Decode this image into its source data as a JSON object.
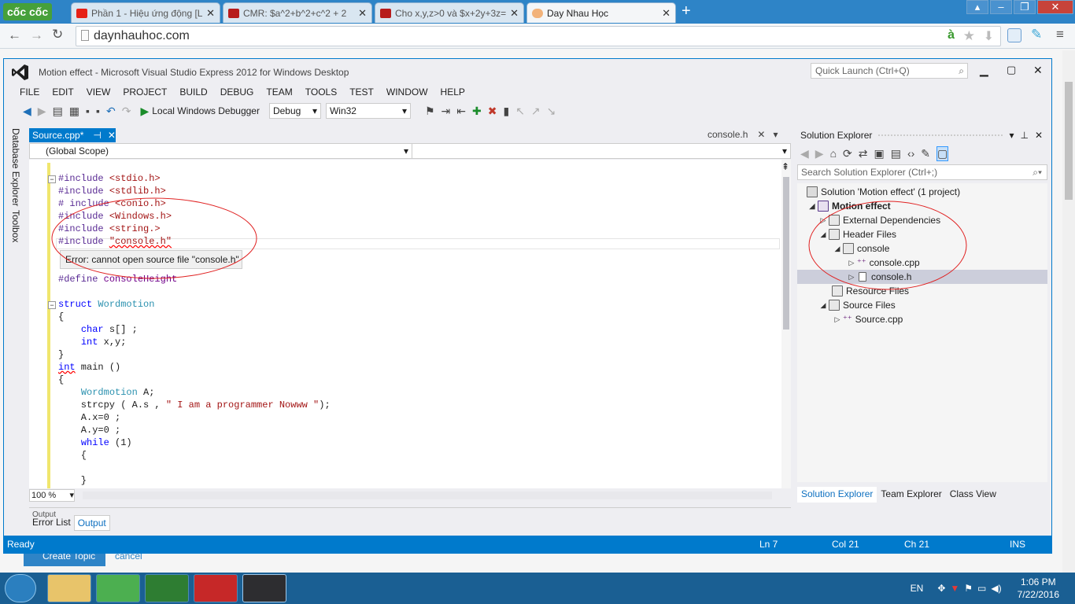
{
  "browser": {
    "logo": "cốc cốc",
    "tabs": [
      {
        "title": "Phần 1 - Hiệu ứng động [L",
        "fav_color": "#e62117"
      },
      {
        "title": "CMR: $a^2+b^2+c^2 + 2",
        "fav_color": "#b71c1c"
      },
      {
        "title": "Cho x,y,z>0 và $x+2y+3z=",
        "fav_color": "#b71c1c"
      },
      {
        "title": "Day Nhau Học",
        "fav_color": "#f2b27a"
      }
    ],
    "url": "daynhauhoc.com"
  },
  "vs": {
    "title": "Motion effect - Microsoft Visual Studio Express 2012 for Windows Desktop",
    "quick_launch": "Quick Launch (Ctrl+Q)",
    "menu": [
      "FILE",
      "EDIT",
      "VIEW",
      "PROJECT",
      "BUILD",
      "DEBUG",
      "TEAM",
      "TOOLS",
      "TEST",
      "WINDOW",
      "HELP"
    ],
    "toolbar": {
      "debugger": "Local Windows Debugger",
      "config": "Debug",
      "platform": "Win32"
    },
    "side_tabs": [
      "Database Explorer",
      "Toolbox"
    ],
    "editor": {
      "active_tab": "Source.cpp*",
      "other_tab": "console.h",
      "scope": "(Global Scope)",
      "tooltip": "Error: cannot open source file \"console.h\"",
      "zoom": "100 %"
    },
    "bottom_tabs": [
      "Error List",
      "Output"
    ],
    "output_label": "Output",
    "status": {
      "ready": "Ready",
      "ln": "Ln 7",
      "col": "Col 21",
      "ch": "Ch 21",
      "ins": "INS"
    },
    "solution_explorer": {
      "title": "Solution Explorer",
      "search": "Search Solution Explorer (Ctrl+;)",
      "tree": [
        "Solution 'Motion effect' (1 project)",
        "Motion effect",
        "External Dependencies",
        "Header Files",
        "console",
        "console.cpp",
        "console.h",
        "Resource Files",
        "Source Files",
        "Source.cpp"
      ],
      "tabs": [
        "Solution Explorer",
        "Team Explorer",
        "Class View"
      ]
    }
  },
  "background_page": {
    "create_topic": "Create Topic",
    "cancel": "cancel"
  },
  "taskbar": {
    "lang": "EN",
    "time": "1:06 PM",
    "date": "7/22/2016"
  }
}
